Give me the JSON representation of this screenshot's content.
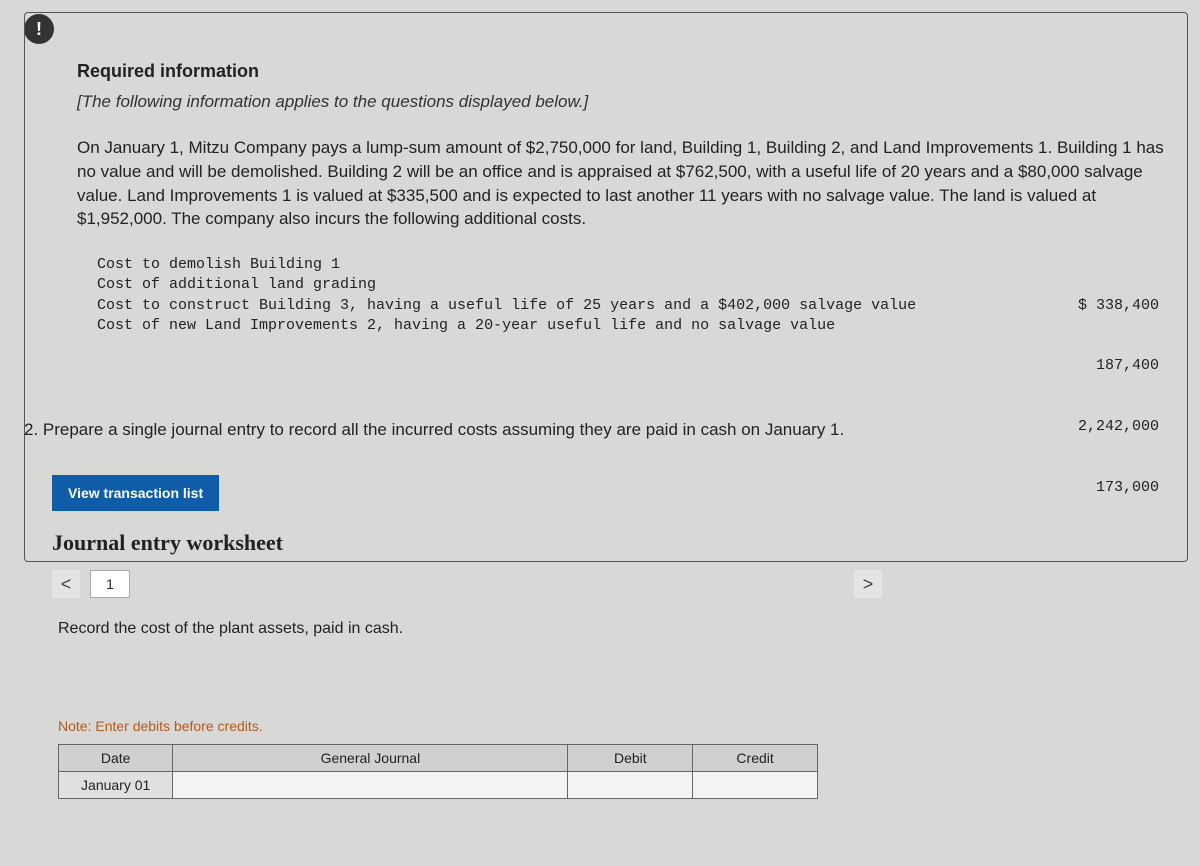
{
  "badge": "!",
  "required": {
    "title": "Required information",
    "subtitle": "[The following information applies to the questions displayed below.]",
    "body": "On January 1, Mitzu Company pays a lump-sum amount of $2,750,000 for land, Building 1, Building 2, and Land Improvements 1. Building 1 has no value and will be demolished. Building 2 will be an office and is appraised at $762,500, with a useful life of 20 years and a $80,000 salvage value. Land Improvements 1 is valued at $335,500 and is expected to last another 11 years with no salvage value. The land is valued at $1,952,000. The company also incurs the following additional costs.",
    "costs": {
      "labels": [
        "Cost to demolish Building 1",
        "Cost of additional land grading",
        "Cost to construct Building 3, having a useful life of 25 years and a $402,000 salvage value",
        "Cost of new Land Improvements 2, having a 20-year useful life and no salvage value"
      ],
      "values": [
        "$ 338,400",
        "187,400",
        "2,242,000",
        "173,000"
      ]
    }
  },
  "question": "2. Prepare a single journal entry to record all the incurred costs assuming they are paid in cash on January 1.",
  "view_button": "View transaction list",
  "worksheet": {
    "title": "Journal entry worksheet",
    "prev": "<",
    "page": "1",
    "next": ">",
    "instruction": "Record the cost of the plant assets, paid in cash.",
    "note": "Note: Enter debits before credits.",
    "headers": {
      "date": "Date",
      "journal": "General Journal",
      "debit": "Debit",
      "credit": "Credit"
    },
    "rows": [
      {
        "date": "January 01",
        "journal": "",
        "debit": "",
        "credit": ""
      }
    ]
  }
}
